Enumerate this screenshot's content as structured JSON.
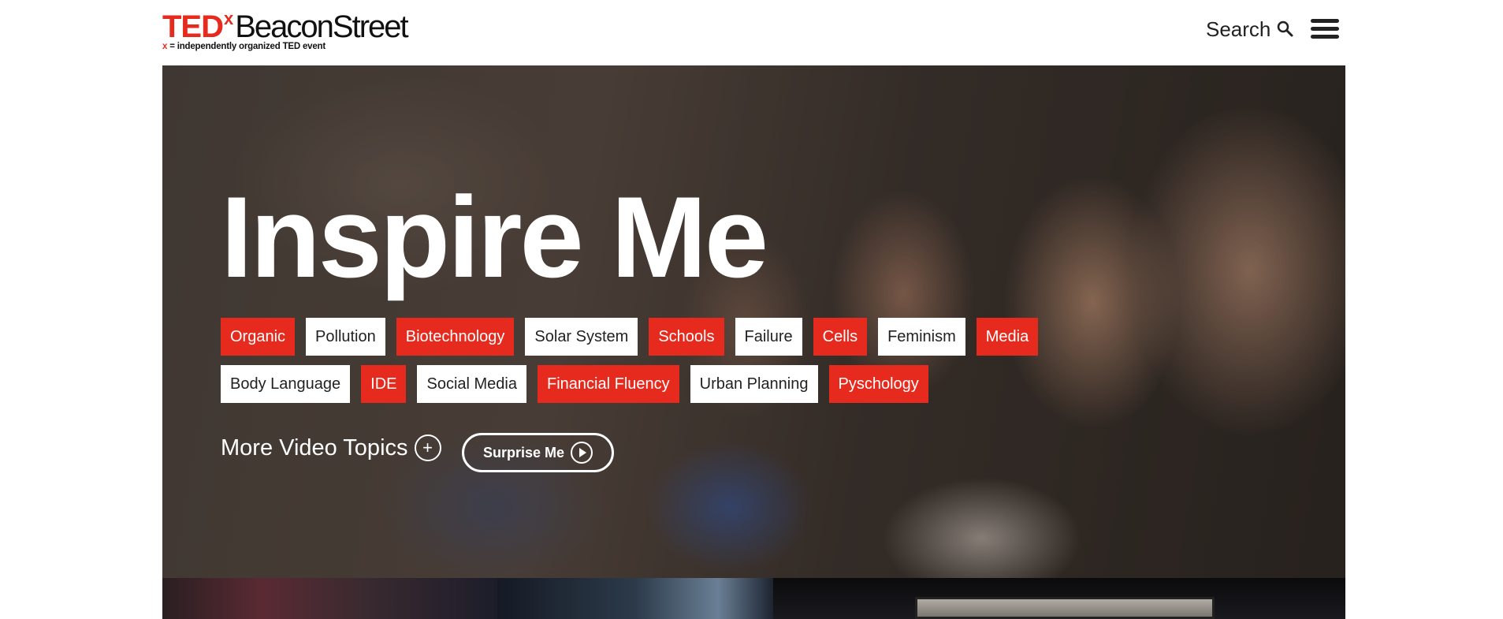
{
  "header": {
    "logo": {
      "ted": "TED",
      "x": "x",
      "name": "BeaconStreet",
      "tagline_x": "x",
      "tagline": "= independently organized TED event"
    },
    "search_label": "Search",
    "search_icon": "search-icon",
    "menu_icon": "hamburger-menu-icon"
  },
  "hero": {
    "title": "Inspire Me",
    "tag_rows": [
      [
        {
          "label": "Organic",
          "style": "red"
        },
        {
          "label": "Pollution",
          "style": "white"
        },
        {
          "label": "Biotechnology",
          "style": "red"
        },
        {
          "label": "Solar System",
          "style": "white"
        },
        {
          "label": "Schools",
          "style": "red"
        },
        {
          "label": "Failure",
          "style": "white"
        },
        {
          "label": "Cells",
          "style": "red"
        },
        {
          "label": "Feminism",
          "style": "white"
        },
        {
          "label": "Media",
          "style": "red"
        }
      ],
      [
        {
          "label": "Body Language",
          "style": "white"
        },
        {
          "label": "IDE",
          "style": "red"
        },
        {
          "label": "Social Media",
          "style": "white"
        },
        {
          "label": "Financial Fluency",
          "style": "red"
        },
        {
          "label": "Urban Planning",
          "style": "white"
        },
        {
          "label": "Pyschology",
          "style": "red"
        }
      ]
    ],
    "more_topics_label": "More Video Topics",
    "more_topics_icon": "plus-circle-icon",
    "surprise_label": "Surprise Me",
    "surprise_icon": "play-circle-icon"
  },
  "colors": {
    "brand_red": "#e62b1e",
    "text_dark": "#222222",
    "white": "#ffffff"
  }
}
